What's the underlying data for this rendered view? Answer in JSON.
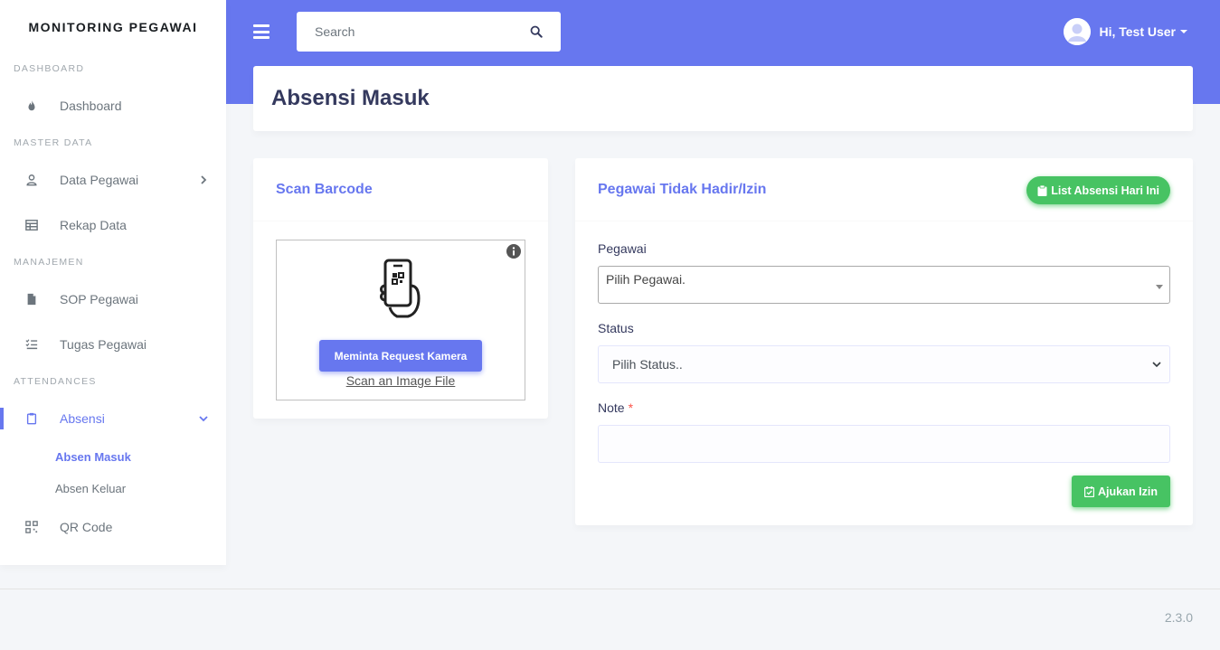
{
  "brand": "MONITORING PEGAWAI",
  "sidebar": {
    "sections": {
      "dashboard": "DASHBOARD",
      "master_data": "MASTER DATA",
      "manajemen": "MANAJEMEN",
      "attendances": "ATTENDANCES"
    },
    "items": {
      "dashboard": "Dashboard",
      "data_pegawai": "Data Pegawai",
      "rekap_data": "Rekap Data",
      "sop_pegawai": "SOP Pegawai",
      "tugas_pegawai": "Tugas Pegawai",
      "absensi": "Absensi",
      "absen_masuk": "Absen Masuk",
      "absen_keluar": "Absen Keluar",
      "qr_code": "QR Code"
    }
  },
  "navbar": {
    "search_placeholder": "Search",
    "user_greeting": "Hi, Test User"
  },
  "page": {
    "title": "Absensi Masuk"
  },
  "scan_card": {
    "title": "Scan Barcode",
    "camera_button": "Meminta Request Kamera",
    "scan_file_link": "Scan an Image File"
  },
  "form_card": {
    "title": "Pegawai Tidak Hadir/Izin",
    "list_button": "List Absensi Hari Ini",
    "pegawai_label": "Pegawai",
    "pegawai_value": "Pilih Pegawai.",
    "status_label": "Status",
    "status_value": "Pilih Status..",
    "note_label": "Note",
    "required_mark": "*",
    "submit_button": "Ajukan Izin"
  },
  "footer": {
    "version": "2.3.0"
  },
  "colors": {
    "primary": "#6777ef",
    "success": "#47c363",
    "danger": "#fc544b"
  }
}
